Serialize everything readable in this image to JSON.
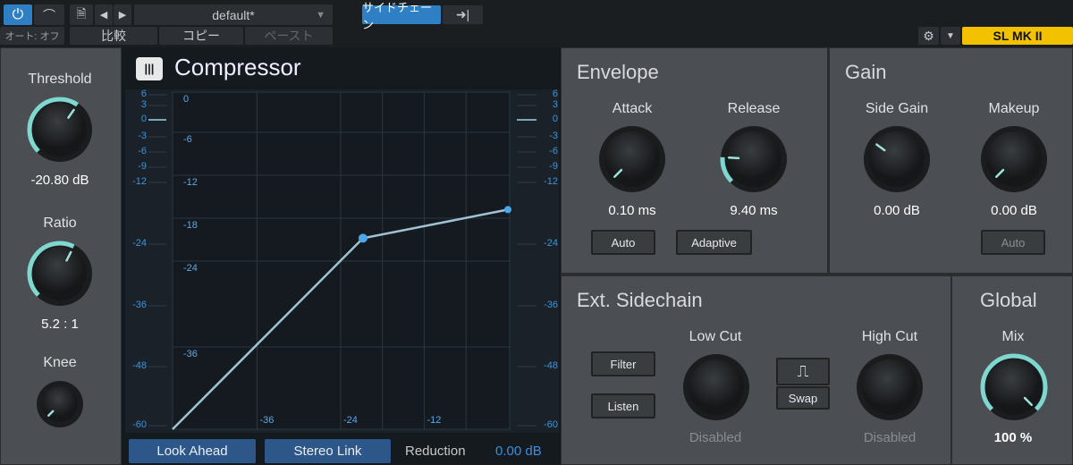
{
  "topbar": {
    "power_icon": "power-icon",
    "curve_icon": "automation-curve-icon",
    "auto_label": "オート: オフ",
    "preset": "default*",
    "compare": "比較",
    "copy": "コピー",
    "paste": "ペースト",
    "sidechain": "サイドチェーン",
    "sidechain_route_icon": "arrow-to-bar-icon",
    "device": "SL MK II"
  },
  "left": {
    "threshold": {
      "label": "Threshold",
      "value": "-20.80 dB",
      "level": 0.63
    },
    "ratio": {
      "label": "Ratio",
      "value": "5.2 : 1",
      "level": 0.6
    },
    "knee": {
      "label": "Knee",
      "level": 0.0
    }
  },
  "center": {
    "title": "Compressor",
    "look_ahead": "Look Ahead",
    "stereo_link": "Stereo Link",
    "reduction_label": "Reduction",
    "reduction_value": "0.00 dB",
    "meter_ticks": [
      "6",
      "3",
      "0",
      "-3",
      "-6",
      "-9",
      "-12",
      "-24",
      "-36",
      "-48",
      "-60"
    ],
    "graph": {
      "y_ticks": [
        "0",
        "-6",
        "-12",
        "-18",
        "-24",
        "-36"
      ],
      "x_ticks": [
        "-36",
        "-24",
        "-12"
      ],
      "threshold_db": -20.8,
      "ratio": 5.2,
      "curve": [
        [
          -60,
          -60
        ],
        [
          -20.8,
          -20.8
        ],
        [
          0,
          -16.8
        ]
      ]
    }
  },
  "envelope": {
    "title": "Envelope",
    "attack": {
      "label": "Attack",
      "value": "0.10 ms",
      "level": 0.0
    },
    "release": {
      "label": "Release",
      "value": "9.40 ms",
      "level": 0.18
    },
    "auto": "Auto",
    "adaptive": "Adaptive"
  },
  "gain": {
    "title": "Gain",
    "side_gain": {
      "label": "Side Gain",
      "value": "0.00 dB",
      "level": 0.3
    },
    "makeup": {
      "label": "Makeup",
      "value": "0.00 dB",
      "level": 0.0
    },
    "auto": "Auto"
  },
  "sidechain": {
    "title": "Ext. Sidechain",
    "filter": "Filter",
    "listen": "Listen",
    "low_cut": {
      "label": "Low Cut",
      "value": "Disabled"
    },
    "high_cut": {
      "label": "High Cut",
      "value": "Disabled"
    },
    "swap": "Swap",
    "swap_icon": "bandpass-filter-icon"
  },
  "global": {
    "title": "Global",
    "mix": {
      "label": "Mix",
      "value": "100 %",
      "level": 1.0
    }
  },
  "colors": {
    "accent": "#2e7fc4",
    "knob_arc": "#7fd8d0",
    "device": "#f2c200",
    "graph_line": "#9fc3d3"
  }
}
